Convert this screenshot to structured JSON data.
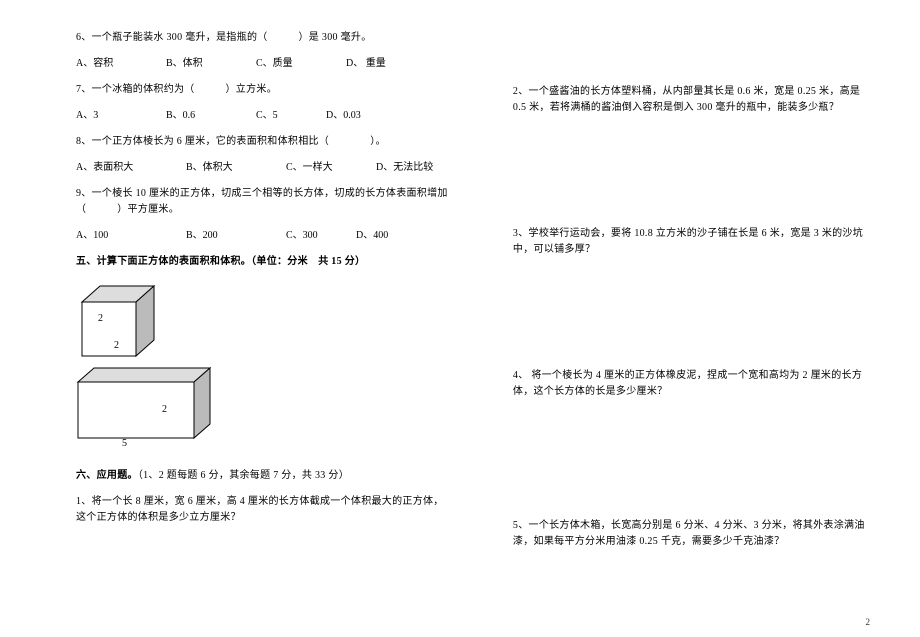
{
  "left": {
    "q6": "6、一个瓶子能装水 300 毫升，是指瓶的（　　　）是 300 毫升。",
    "q6a": "A、容积",
    "q6b": "B、体积",
    "q6c": "C、质量",
    "q6d": "D、 重量",
    "q7": "7、一个冰箱的体积约为（　　　）立方米。",
    "q7a": "A、3",
    "q7b": "B、0.6",
    "q7c": "C、5",
    "q7d": "D、0.03",
    "q8": "8、一个正方体棱长为 6 厘米，它的表面积和体积相比（　　　　）。",
    "q8a": "A、表面积大",
    "q8b": "B、体积大",
    "q8c": "C、一样大",
    "q8d": "D、无法比较",
    "q9": "9、一个棱长 10 厘米的正方体，切成三个相等的长方体，切成的长方体表面积增加（　　　）平方厘米。",
    "q9a": "A、100",
    "q9b": "B、200",
    "q9c": "C、300",
    "q9d": "D、400",
    "sec5": "五、计算下面正方体的表面积和体积。（单位：分米　共 15 分）",
    "cube_dim1": "2",
    "cube_dim2": "2",
    "cuboid_h": "2",
    "cuboid_w": "5",
    "sec6": "六、应用题。（1、2 题每题 6 分，其余每题 7 分，共 33 分）",
    "p1": "1、将一个长 8 厘米，宽 6 厘米，高 4 厘米的长方体截成一个体积最大的正方体，这个正方体的体积是多少立方厘米？"
  },
  "right": {
    "p2": "2、一个盛酱油的长方体塑料桶，从内部量其长是 0.6 米，宽是 0.25 米，高是 0.5 米，若将满桶的酱油倒入容积是倒入 300 毫升的瓶中，能装多少瓶？",
    "p3": "3、学校举行运动会，要将 10.8 立方米的沙子铺在长是 6 米，宽是 3 米的沙坑中，可以铺多厚？",
    "p4": "4、 将一个棱长为 4 厘米的正方体橡皮泥，捏成一个宽和高均为 2 厘米的长方体，这个长方体的长是多少厘米？",
    "p5": "5、一个长方体木箱，长宽高分别是 6 分米、4 分米、3 分米，将其外表涂满油漆，如果每平方分米用油漆 0.25 千克，需要多少千克油漆？"
  },
  "page": "2"
}
